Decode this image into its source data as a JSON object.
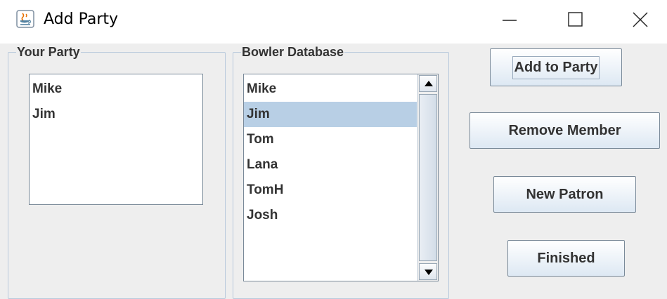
{
  "window": {
    "title": "Add Party",
    "icon": "java-coffee-cup-icon",
    "controls": [
      "minimize-icon",
      "maximize-icon",
      "close-icon"
    ]
  },
  "your_party": {
    "label": "Your Party",
    "members": [
      "Mike",
      "Jim"
    ]
  },
  "bowler_database": {
    "label": "Bowler Database",
    "bowlers": [
      "Mike",
      "Jim",
      "Tom",
      "Lana",
      "TomH",
      "Josh"
    ],
    "selected": "Jim"
  },
  "buttons": {
    "add_to_party": "Add to Party",
    "remove_member": "Remove Member",
    "new_patron": "New Patron",
    "finished": "Finished"
  },
  "colors": {
    "selection": "#b8cfe5",
    "window_bg": "#eeeeee",
    "border": "#b8c9dc"
  }
}
